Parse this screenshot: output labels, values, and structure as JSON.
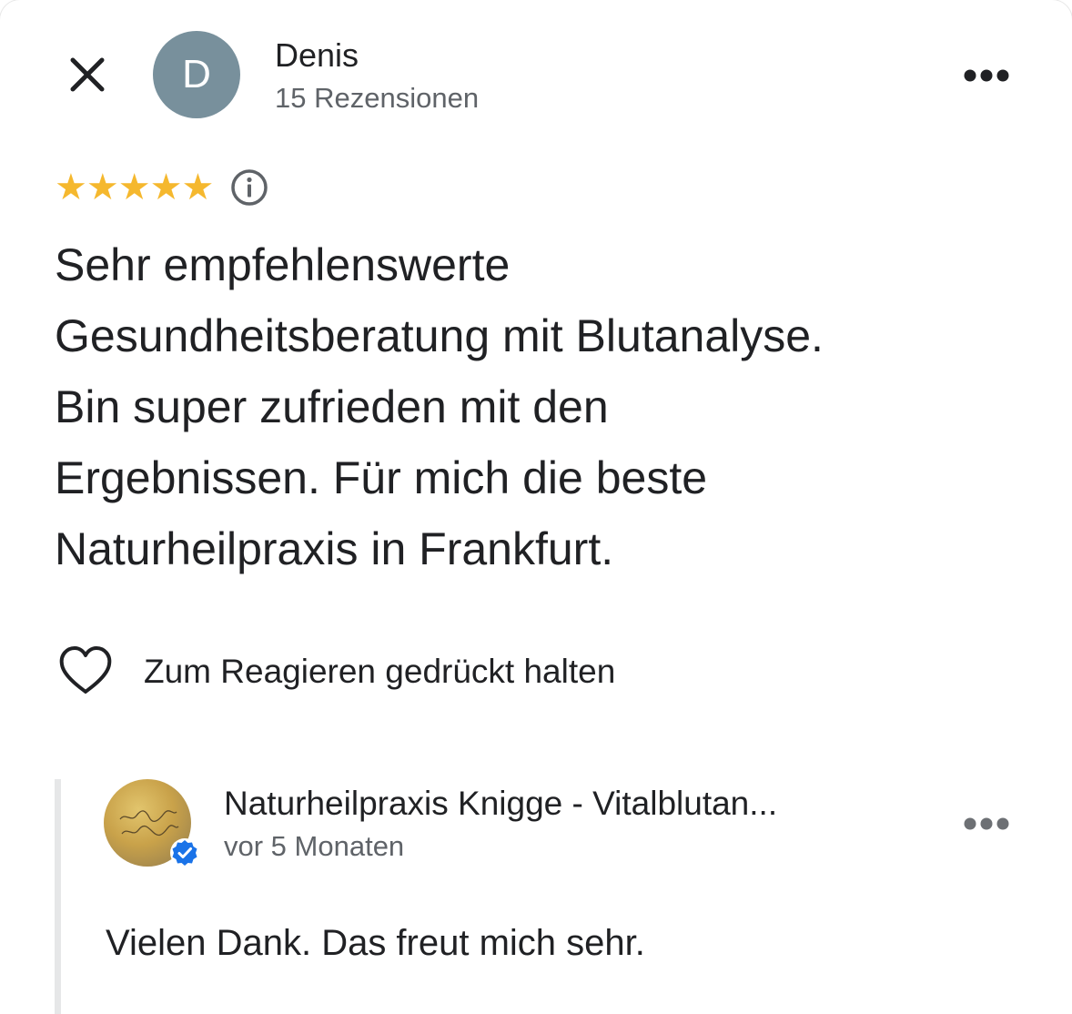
{
  "reviewer": {
    "avatar_letter": "D",
    "name": "Denis",
    "review_count": "15 Rezensionen"
  },
  "review": {
    "rating": 5,
    "max_rating": 5,
    "stars": [
      "★",
      "★",
      "★",
      "★",
      "★"
    ],
    "text": "Sehr empfehlenswerte\nGesundheitsberatung mit Blutanalyse.\nBin super zufrieden mit den\nErgebnissen. Für mich die beste\nNaturheilpraxis in Frankfurt.",
    "react_label": "Zum Reagieren gedrückt halten"
  },
  "owner_reply": {
    "name": "Naturheilpraxis Knigge - Vitalblutan...",
    "time": "vor 5 Monaten",
    "text": "Vielen Dank. Das freut mich sehr."
  },
  "colors": {
    "star": "#f5b82e",
    "avatar_bg": "#78909c",
    "verified_badge": "#1a73e8",
    "text_primary": "#202124",
    "text_secondary": "#5f6368"
  },
  "icons": {
    "close": "close-icon",
    "more": "more-horizontal-icon",
    "info": "info-icon",
    "heart": "heart-outline-icon",
    "verified": "verified-badge-icon"
  }
}
